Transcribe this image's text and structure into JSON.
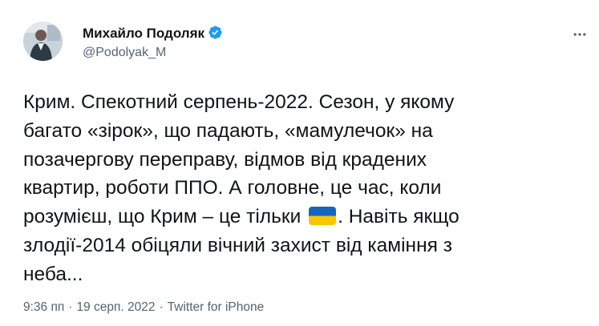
{
  "author": {
    "name": "Михайло Подоляк",
    "handle": "@Podolyak_M",
    "verified": true
  },
  "tweet": {
    "lines": [
      "Крим. Спекотний серпень-2022. Сезон, у якому",
      "багато «зірок», що падають, «мамулечок» на",
      "позачергову переправу, відмов від крадених",
      "квартир, роботи ППО. А головне, це час, коли"
    ],
    "line5_before_flag": "розумієш, що Крим – це тільки ",
    "flag_icon": "ukraine-flag-emoji",
    "line5_after_flag": ". Навіть якщо",
    "lines_end": [
      "злодії-2014 обіцяли вічний захист від каміння з",
      "неба..."
    ]
  },
  "meta": {
    "time": "9:36 пп",
    "date": "19 серп. 2022",
    "source": "Twitter for iPhone",
    "separator": "·"
  },
  "colors": {
    "text": "#0f1419",
    "secondary": "#536471",
    "verified_blue": "#1d9bf0",
    "flag_blue": "#1565c0",
    "flag_yellow": "#f7c600"
  }
}
